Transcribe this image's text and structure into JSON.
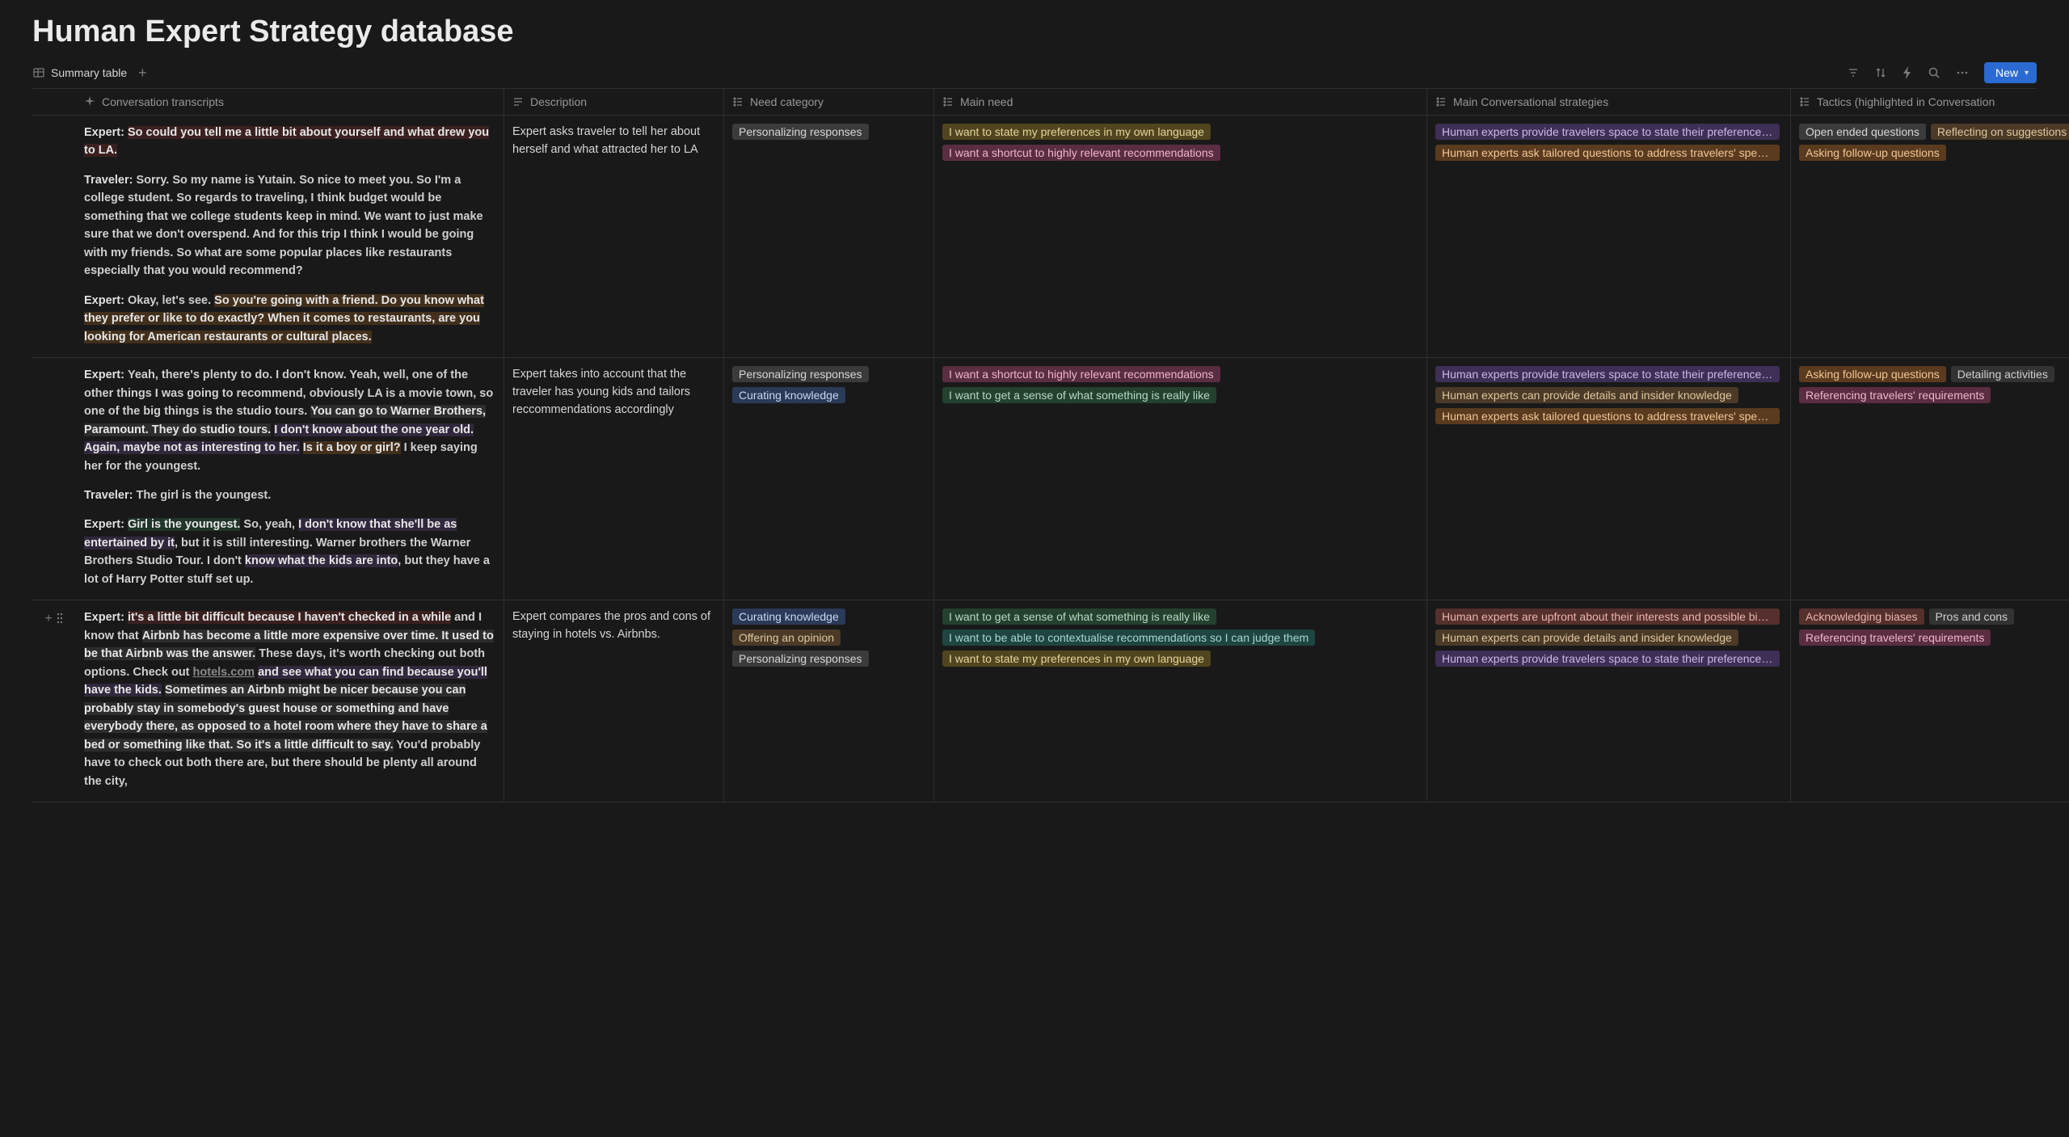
{
  "title": "Human Expert Strategy database",
  "tab": {
    "label": "Summary table"
  },
  "toolbar": {
    "new_label": "New"
  },
  "columns": [
    {
      "icon": "sparkle",
      "label": "Conversation transcripts"
    },
    {
      "icon": "text",
      "label": "Description"
    },
    {
      "icon": "list",
      "label": "Need category"
    },
    {
      "icon": "list",
      "label": "Main need"
    },
    {
      "icon": "list",
      "label": "Main Conversational strategies"
    },
    {
      "icon": "list",
      "label": "Tactics (highlighted in Conversation"
    }
  ],
  "tag_colors": {
    "Personalizing responses": "gray",
    "Curating knowledge": "blue",
    "Offering an opinion": "brown",
    "I want  to state my preferences in my own language": "yellow",
    "I want a shortcut to highly relevant recommendations": "pink",
    "I want to get a sense of what something is really like": "green",
    "I want to be able to contextualise recommendations so I can judge them": "teal",
    "Human experts provide travelers space to state their preferences in their own language": "purple",
    "Human experts ask tailored questions to address travelers' specific needs": "orange",
    "Human experts can provide details and insider knowledge": "brown",
    "Human experts are upfront about their interests and possible biases": "red",
    "Open ended questions": "gray",
    "Reflecting on suggestions provided": "brown",
    "Asking follow-up questions": "orange",
    "Referencing travelers' requirements": "pink",
    "Detailing activities": "ltgray",
    "Acknowledging biases": "red",
    "Pros and cons": "ltgray"
  },
  "rows": [
    {
      "transcript": [
        {
          "speaker": "Expert:",
          "runs": [
            {
              "t": "So could you tell me a little bit about yourself and what drew you to LA.",
              "hl": "red"
            }
          ]
        },
        {
          "speaker": "Traveler:",
          "runs": [
            {
              "t": " Sorry. So my name is Yutain. So nice to meet you. So I'm a college student. So regards to traveling, I think budget would be something that we college students keep in mind. We want to just make sure that we don't overspend. And for this trip I think I would be going with my friends. So what are some popular places like restaurants especially that you would recommend?"
            }
          ]
        },
        {
          "speaker": "Expert:",
          "runs": [
            {
              "t": " Okay, let's see. "
            },
            {
              "t": "So you're going with a friend. Do you know what they prefer or like to do exactly? When it comes to restaurants, are you looking for American restaurants or cultural places.",
              "hl": "orng"
            }
          ]
        }
      ],
      "description": "Expert asks traveler to tell her about herself and what attracted her to LA",
      "need_category": [
        "Personalizing responses"
      ],
      "main_need": [
        "I want  to state my preferences in my own language",
        "I want a shortcut to highly relevant recommendations"
      ],
      "strategies": [
        "Human experts provide travelers space to state their preferences in their own language",
        "Human experts ask tailored questions to address travelers' specific needs"
      ],
      "tactics": [
        "Open ended questions",
        "Reflecting on suggestions provided",
        "Asking follow-up questions"
      ]
    },
    {
      "transcript": [
        {
          "speaker": "Expert:",
          "runs": [
            {
              "t": " Yeah, there's plenty to do. I don't know. Yeah, well, one of the other things I was going to recommend, obviously LA is a movie town, so one of the big things is the studio tours. "
            },
            {
              "t": "You can go to Warner Brothers, Paramount. They do studio tours.",
              "hl": "gry"
            },
            {
              "t": " "
            },
            {
              "t": "I don't know about the one year old. Again, maybe not as interesting to her.",
              "hl": "pur"
            },
            {
              "t": " "
            },
            {
              "t": "Is it a boy or girl?",
              "hl": "orng"
            },
            {
              "t": " I keep saying her for the youngest."
            }
          ]
        },
        {
          "speaker": "Traveler:",
          "runs": [
            {
              "t": " The girl is the youngest."
            }
          ]
        },
        {
          "speaker": "Expert:",
          "runs": [
            {
              "t": "Girl is the youngest.",
              "hl": "grn"
            },
            {
              "t": " So, yeah, "
            },
            {
              "t": "I don't know that she'll be as entertained by it",
              "hl": "pur"
            },
            {
              "t": ", but it is still interesting. Warner brothers the Warner Brothers Studio Tour. I don't "
            },
            {
              "t": "know what the kids are into",
              "hl": "pur"
            },
            {
              "t": ", but they have a lot of Harry Potter stuff set up."
            }
          ]
        }
      ],
      "description": "Expert takes into account that the traveler has young kids and tailors reccommendations accordingly",
      "need_category": [
        "Personalizing responses",
        "Curating knowledge"
      ],
      "main_need": [
        "I want a shortcut to highly relevant recommendations",
        "I want to get a sense of what something is really like"
      ],
      "strategies": [
        "Human experts provide travelers space to state their preferences in their own language",
        "Human experts can provide details and insider knowledge",
        "Human experts ask tailored questions to address travelers' specific needs"
      ],
      "tactics": [
        "Asking follow-up questions",
        "Detailing activities",
        "Referencing travelers' requirements"
      ]
    },
    {
      "hovered": true,
      "transcript": [
        {
          "speaker": "Expert:",
          "runs": [
            {
              "t": "it's a little bit difficult because I haven't checked in a while",
              "hl": "red"
            },
            {
              "t": " and I know that "
            },
            {
              "t": "Airbnb has become a little more expensive over time. It used to be that Airbnb was the answer.",
              "hl": "gry"
            },
            {
              "t": " These days, it's worth checking out both options. Check out "
            },
            {
              "t": "hotels.com",
              "link": true
            },
            {
              "t": " "
            },
            {
              "t": "and see what you can find because you'll have the kids.",
              "hl": "pur"
            },
            {
              "t": " "
            },
            {
              "t": "Sometimes an Airbnb might be nicer because you can probably stay in somebody's guest house or something and have everybody there, as opposed to a hotel room where they have to share a bed or something like that. So it's a little difficult to say.",
              "hl": "gry"
            },
            {
              "t": " You'd probably have to check out both there are, but there should be plenty all around the city,"
            }
          ]
        }
      ],
      "description": "Expert compares the pros and cons of staying in hotels vs. Airbnbs.",
      "need_category": [
        "Curating knowledge",
        "Offering an opinion",
        "Personalizing responses"
      ],
      "main_need": [
        "I want to get a sense of what something is really like",
        "I want to be able to contextualise recommendations so I can judge them",
        "I want  to state my preferences in my own language"
      ],
      "strategies": [
        "Human experts are upfront about their interests and possible biases",
        "Human experts can provide details and insider knowledge",
        "Human experts provide travelers space to state their preferences in their own language"
      ],
      "tactics": [
        "Acknowledging biases",
        "Pros and cons",
        "Referencing travelers' requirements"
      ]
    }
  ]
}
